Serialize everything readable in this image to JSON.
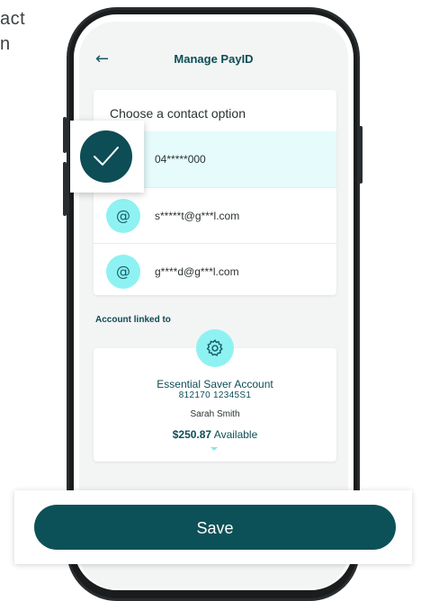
{
  "background_text": [
    "act",
    "n"
  ],
  "header": {
    "back_icon": "arrow-left-icon",
    "title": "Manage PayID"
  },
  "contact_options": {
    "heading": "Choose a contact option",
    "items": [
      {
        "label": "04*****000",
        "icon": "checkmark-icon",
        "selected": true
      },
      {
        "label": "s*****t@g***l.com",
        "icon": "at-sign-icon",
        "selected": false
      },
      {
        "label": "g****d@g***l.com",
        "icon": "at-sign-icon",
        "selected": false
      }
    ]
  },
  "account": {
    "section_label": "Account linked to",
    "icon": "gear-icon",
    "name": "Essential Saver Account",
    "number": "812170  12345S1",
    "holder": "Sarah Smith",
    "balance_amount": "$250.87",
    "balance_suffix": "Available"
  },
  "actions": {
    "save_label": "Save"
  },
  "colors": {
    "primary": "#0d5158",
    "accent": "#8ef2f2",
    "selected_bg": "#e6fbfb"
  }
}
